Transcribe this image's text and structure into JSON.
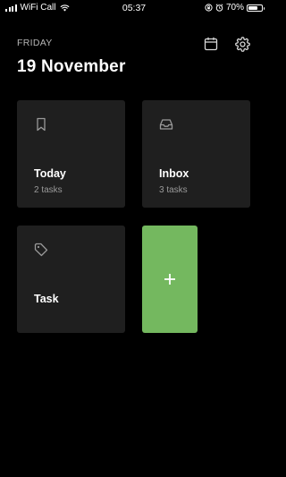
{
  "status_bar": {
    "carrier": "WiFi Call",
    "time": "05:37",
    "battery_percent": "70%",
    "battery_level": 0.7,
    "icons": [
      "signal-icon",
      "wifi-icon",
      "rotation-lock-icon",
      "alarm-icon",
      "battery-icon"
    ]
  },
  "header": {
    "day": "FRIDAY",
    "date": "19 November",
    "icons": [
      "calendar-icon",
      "gear-icon"
    ]
  },
  "cards": {
    "today": {
      "title": "Today",
      "subtitle": "2 tasks",
      "icon": "bookmark-icon"
    },
    "inbox": {
      "title": "Inbox",
      "subtitle": "3 tasks",
      "icon": "inbox-icon"
    },
    "task": {
      "title": "Task",
      "icon": "tag-icon"
    }
  },
  "add_button": {
    "icon": "plus-icon"
  },
  "colors": {
    "background": "#000000",
    "card": "#1f1f1f",
    "accent": "#74b85f",
    "muted_text": "#9a9a9a"
  }
}
